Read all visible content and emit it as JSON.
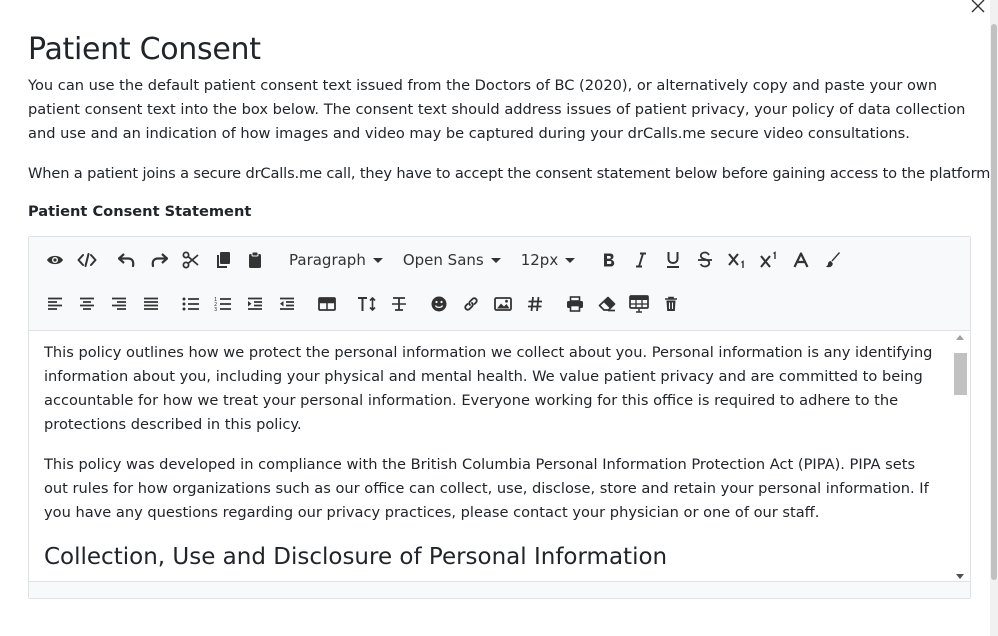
{
  "modal": {
    "title": "Patient Consent",
    "intro_paragraph": "You can use the default patient consent text issued from the Doctors of BC (2020), or alternatively copy and paste your own patient consent text into the box below. The consent text should address issues of patient privacy, your policy of data collection and use and an indication of how images and video may be captured during your drCalls.me secure video consultations.",
    "join_paragraph": "When a patient joins a secure drCalls.me call, they have to accept the consent statement below before gaining access to the platform.",
    "field_label": "Patient Consent Statement"
  },
  "toolbar": {
    "block_format": "Paragraph",
    "font_family": "Open Sans",
    "font_size": "12px",
    "row1_icons": [
      "eye-icon",
      "code-view-icon",
      "undo-icon",
      "redo-icon",
      "scissors-icon",
      "copy-icon",
      "paste-icon"
    ],
    "row1_format_icons": [
      "bold-icon",
      "italic-icon",
      "underline-icon",
      "strikethrough-icon",
      "subscript-icon",
      "superscript-icon",
      "font-color-icon",
      "paint-brush-icon"
    ],
    "row2_icons": [
      "align-left-icon",
      "align-center-icon",
      "align-right-icon",
      "align-justify-icon",
      "unordered-list-icon",
      "ordered-list-icon",
      "indent-icon",
      "outdent-icon",
      "table-icon",
      "line-height-icon",
      "clear-format-icon",
      "emoji-icon",
      "link-icon",
      "image-icon",
      "hashtag-icon",
      "print-icon",
      "eraser-icon",
      "table-edit-icon",
      "trash-icon"
    ]
  },
  "editor": {
    "paragraph1": "This policy outlines how we protect the personal information we collect about you. Personal information is any identifying information about you, including your physical and mental health. We value patient privacy and are committed to being accountable for how we treat your personal information. Everyone working for this office is required to adhere to the protections described in this policy.",
    "paragraph2": "This policy was developed in compliance with the British Columbia Personal Information Protection Act (PIPA). PIPA sets out rules for how organizations such as our office can collect, use, disclose, store and retain your personal information. If you have any questions regarding our privacy practices, please contact your physician or one of our staff.",
    "heading": "Collection, Use and Disclosure of Personal Information"
  }
}
